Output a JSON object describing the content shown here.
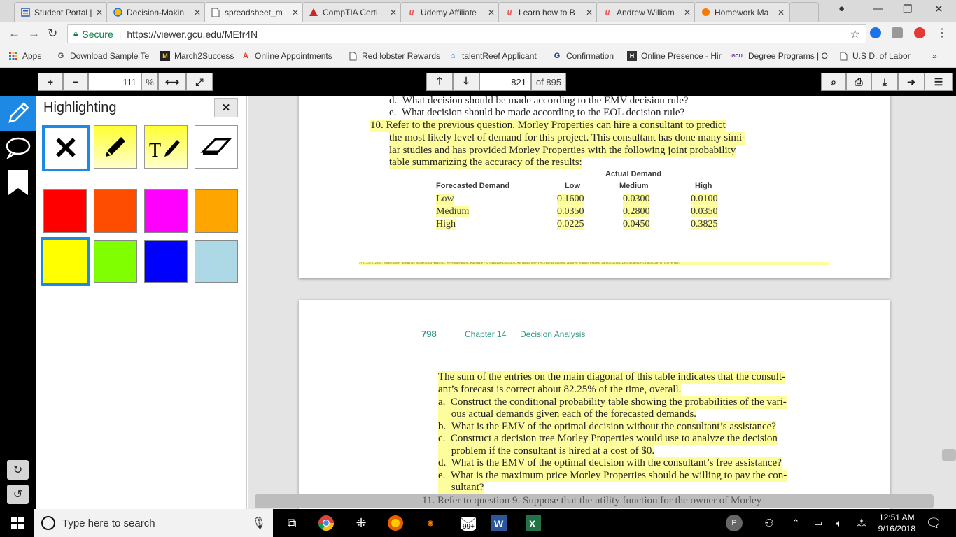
{
  "browser": {
    "tabs": [
      {
        "title": "Student Portal |",
        "icon": "gcu-doc-icon",
        "color": "#2a5caa"
      },
      {
        "title": "Decision-Makin",
        "icon": "globe-icon",
        "color": "#1a73e8"
      },
      {
        "title": "spreadsheet_m",
        "icon": "page-icon",
        "color": "#555"
      },
      {
        "title": "CompTIA Certi",
        "icon": "comptia-icon",
        "color": "#c62828"
      },
      {
        "title": "Udemy Affiliate",
        "icon": "udemy-icon",
        "color": "#ec5252"
      },
      {
        "title": "Learn how to B",
        "icon": "udemy-icon",
        "color": "#ec5252"
      },
      {
        "title": "Andrew William",
        "icon": "udemy-icon",
        "color": "#ec5252"
      },
      {
        "title": "Homework Ma",
        "icon": "homework-icon",
        "color": "#f57c00"
      }
    ],
    "secure_label": "Secure",
    "url": "https://viewer.gcu.edu/MEfr4N",
    "bookmarks": [
      {
        "label": "Apps",
        "icon": "apps-icon"
      },
      {
        "label": "Download Sample Te",
        "icon": "g-icon"
      },
      {
        "label": "March2Success",
        "icon": "m2s-icon"
      },
      {
        "label": "Online Appointments",
        "icon": "appt-icon"
      },
      {
        "label": "Red lobster Rewards",
        "icon": "page-icon"
      },
      {
        "label": "talentReef Applicant",
        "icon": "talentreef-icon"
      },
      {
        "label": "Confirmation",
        "icon": "g-icon"
      },
      {
        "label": "Online Presence - Hir",
        "icon": "h-icon"
      },
      {
        "label": "Degree Programs | O",
        "icon": "gcu-icon"
      },
      {
        "label": "U.S D. of Labor",
        "icon": "page-icon"
      }
    ],
    "more_bookmarks": "»"
  },
  "viewer": {
    "zoom": "111",
    "zoom_unit": "%",
    "page": "821",
    "page_total": "of 895"
  },
  "highlight_panel": {
    "title": "Highlighting",
    "tools": [
      "clear-tool",
      "pen-tool",
      "text-tool",
      "eraser-tool"
    ],
    "colors": [
      "#ff0000",
      "#ff4d00",
      "#ff00ff",
      "#ffa500",
      "#ffff00",
      "#7fff00",
      "#0000ff",
      "#add8e6"
    ],
    "selected_color": "#ffff00"
  },
  "document": {
    "page1": {
      "item_d": "d.  What decision should be made according to the EMV decision rule?",
      "item_e": "e.  What decision should be made according to the EOL decision rule?",
      "q10_l1": "10. Refer to the previous question. Morley Properties can hire a consultant to predict",
      "q10_l2": "the most likely level of demand for this project. This consultant has done many simi-",
      "q10_l3": "lar studies and has provided Morley Properties with the following joint probability",
      "q10_l4": "table summarizing the accuracy of the results:",
      "table": {
        "header_group": "Actual Demand",
        "row_header": "Forecasted Demand",
        "columns": [
          "Low",
          "Medium",
          "High"
        ],
        "rows": [
          {
            "label": "Low",
            "values": [
              "0.1600",
              "0.0300",
              "0.0100"
            ]
          },
          {
            "label": "Medium",
            "values": [
              "0.0350",
              "0.2800",
              "0.0350"
            ]
          },
          {
            "label": "High",
            "values": [
              "0.0225",
              "0.0450",
              "0.3825"
            ]
          }
        ]
      },
      "footer": "9781337512954, Spreadsheet Modeling & Decision Analysis, Seventh edition, Ragsdale - © Cengage Learning. All rights reserved. No distribution allowed without express authorization. Distributed by Grand Canyon University."
    },
    "page2": {
      "page_number": "798",
      "chapter": "Chapter 14",
      "chapter_title": "Decision Analysis",
      "lines": [
        "The sum of the entries on the main diagonal of this table indicates that the consult-",
        "ant’s forecast is correct about 82.25% of the time, overall.",
        "a.  Construct the conditional probability table showing the probabilities of the vari-",
        "     ous actual demands given each of the forecasted demands.",
        "b.  What is the EMV of the optimal decision without the consultant’s assistance?",
        "c.  Construct a decision tree Morley Properties would use to analyze the decision",
        "     problem if the consultant is hired at a cost of $0.",
        "d.  What is the EMV of the optimal decision with the consultant’s free assistance?",
        "e.  What is the maximum price Morley Properties should be willing to pay the con-",
        "     sultant?"
      ],
      "q11": "11. Refer to question 9. Suppose that the utility function for the owner of Morley"
    }
  },
  "taskbar": {
    "search_placeholder": "Type here to search",
    "badge": "99+",
    "time": "12:51 AM",
    "date": "9/16/2018",
    "avatar_letter": "P"
  }
}
